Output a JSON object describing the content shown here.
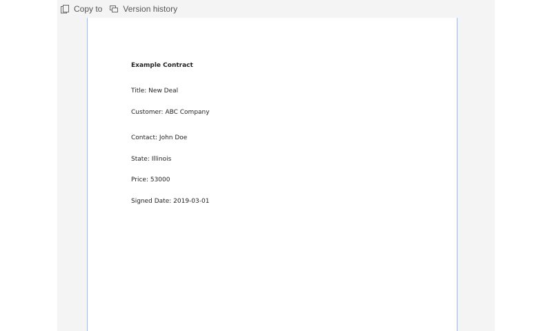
{
  "toolbar": {
    "copy_to": {
      "label": "Copy to",
      "icon": "copy-icon"
    },
    "version_history": {
      "label": "Version history",
      "icon": "version-history-icon"
    }
  },
  "document": {
    "heading": "Example Contract",
    "lines": [
      "Title: New Deal",
      "Customer: ABC Company",
      "Contact: John Doe",
      "State: Illinois",
      "Price: 53000",
      "Signed Date: 2019-03-01"
    ]
  },
  "colors": {
    "viewer_background": "#f4f4f4",
    "page_border": "#aab6e2",
    "toolbar_text": "#555555"
  }
}
